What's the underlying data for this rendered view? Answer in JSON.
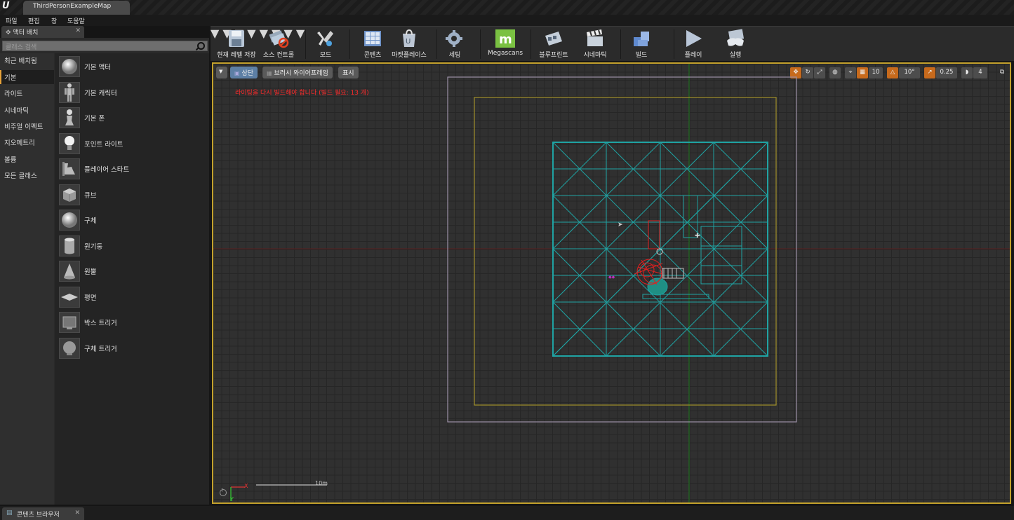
{
  "app": {
    "logo": "U",
    "document_tab": "ThirdPersonExampleMap"
  },
  "menu": [
    "파일",
    "편집",
    "창",
    "도움말"
  ],
  "place_panel": {
    "tab_label": "액터 배치",
    "search_placeholder": "클래스 검색",
    "categories": [
      "최근 배치됨",
      "기본",
      "라이트",
      "시네마틱",
      "비주얼 이펙트",
      "지오메트리",
      "볼륨",
      "모든 클래스"
    ],
    "active_category": "기본",
    "items": [
      "기본 액터",
      "기본 캐릭터",
      "기본 폰",
      "포인트 라이트",
      "플레이어 스타트",
      "큐브",
      "구체",
      "원기둥",
      "원뿔",
      "평면",
      "박스 트리거",
      "구체 트리거"
    ]
  },
  "toolbar": {
    "save": "현재 레벨 저장",
    "source_control": "소스 컨트롤",
    "modes": "모드",
    "content": "콘텐츠",
    "marketplace": "마켓플레이스",
    "settings": "세팅",
    "megascans": "Megascans",
    "blueprints": "블루프린트",
    "cinematics": "시네마틱",
    "build": "빌드",
    "play": "플레이",
    "launch": "실행"
  },
  "viewport": {
    "view_mode": "상단",
    "view_shading": "브러시 와이어프레임",
    "show": "표시",
    "warning": "라이팅을 다시 빌드해야 합니다 (빌드 필요: 13 개)",
    "grid_snap": "10",
    "rotation_snap": "10°",
    "scale_snap": "0.25",
    "camera_speed": "4",
    "scale_label": "10m",
    "axis_x": "X",
    "axis_y": "Y"
  },
  "bottom": {
    "content_browser_tab": "콘텐츠 브라우저"
  }
}
